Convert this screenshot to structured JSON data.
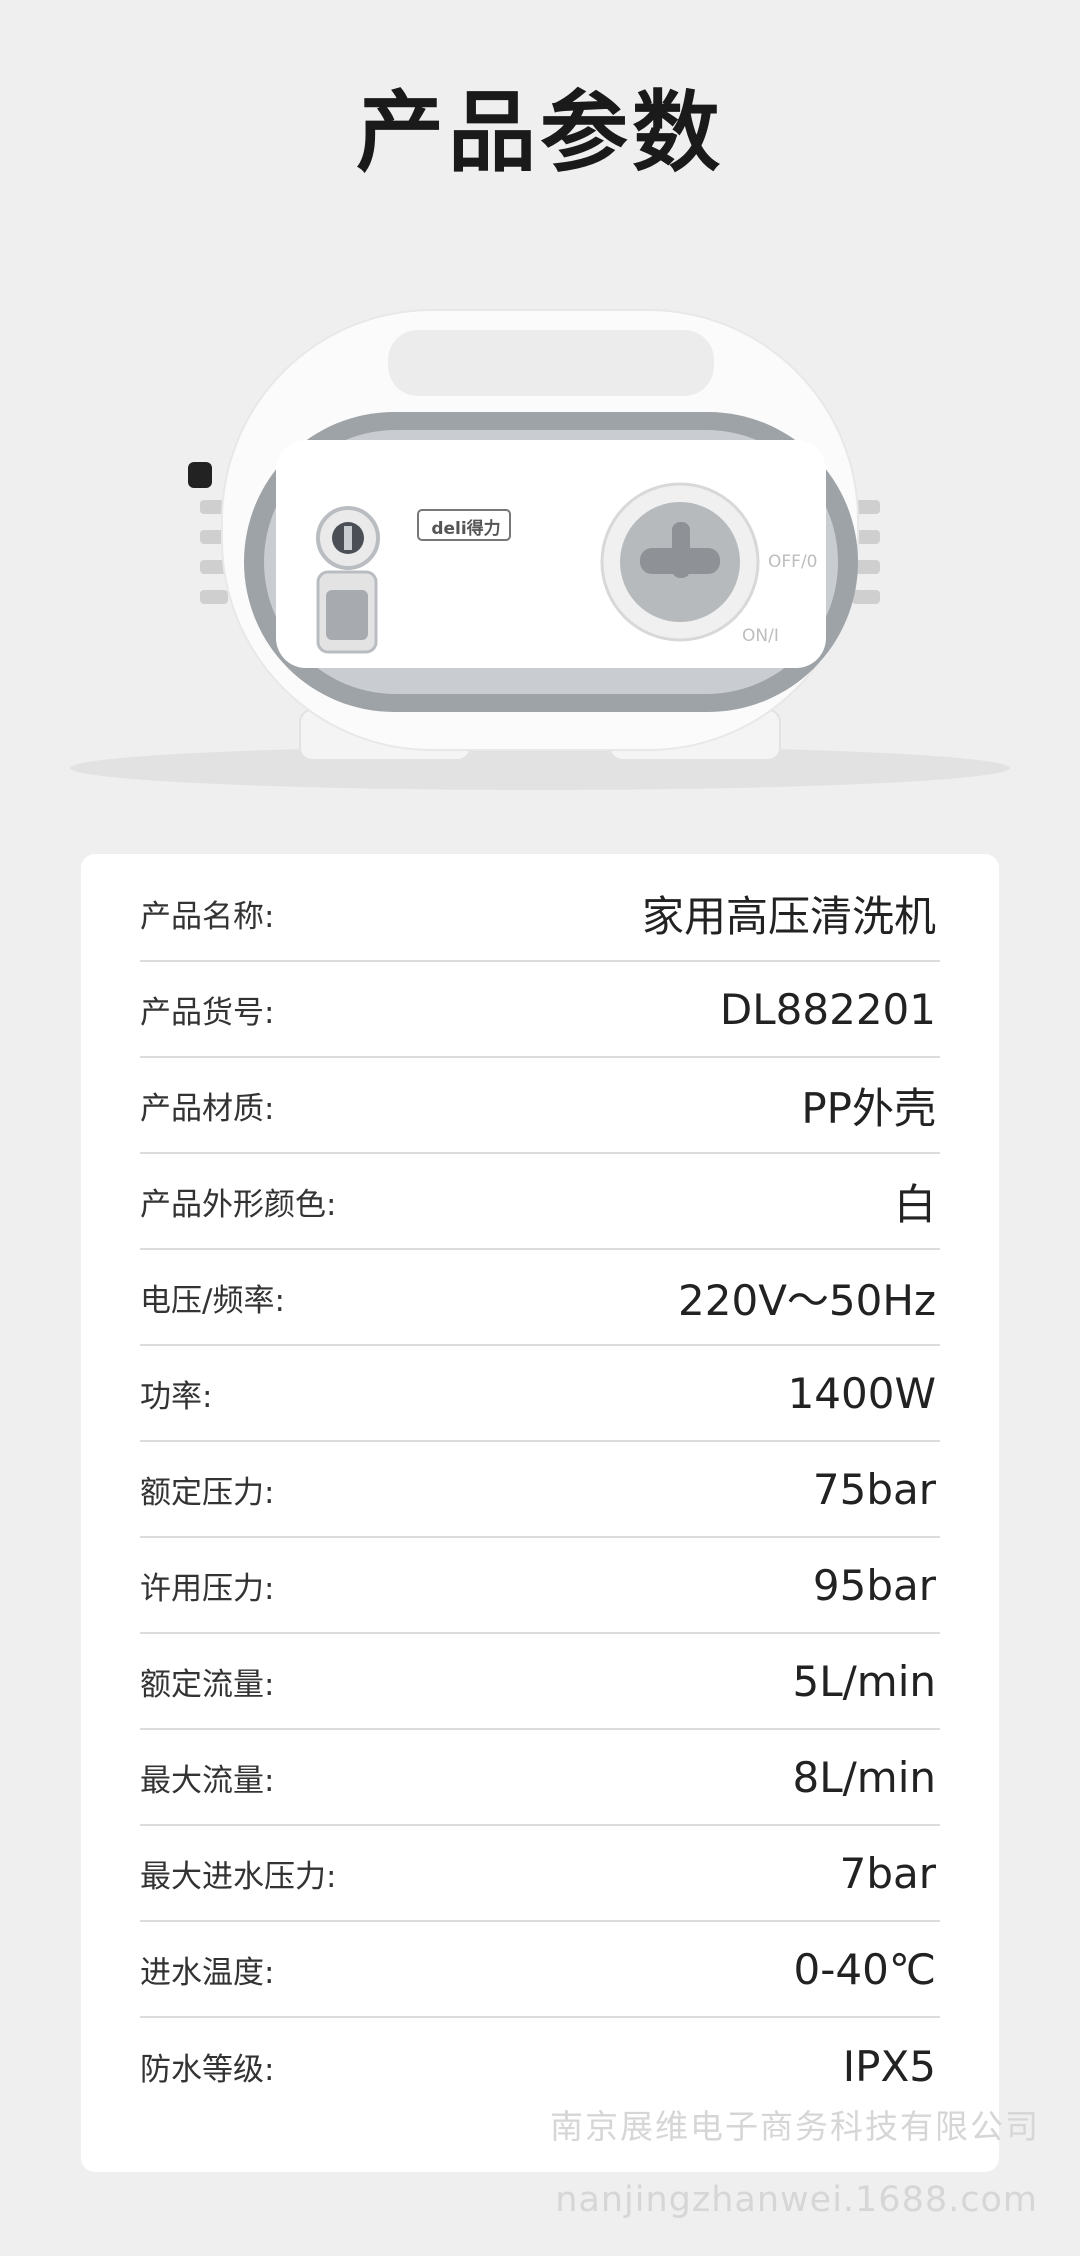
{
  "header": {
    "title": "产品参数"
  },
  "product": {
    "brand_logo": "deli得力",
    "switch_off_label": "OFF/0",
    "switch_on_label": "ON/I"
  },
  "specs": [
    {
      "label": "产品名称:",
      "value": "家用高压清洗机"
    },
    {
      "label": "产品货号:",
      "value": "DL882201"
    },
    {
      "label": "产品材质:",
      "value": "PP外壳"
    },
    {
      "label": "产品外形颜色:",
      "value": "白"
    },
    {
      "label": "电压/频率:",
      "value": "220V～50Hz"
    },
    {
      "label": "功率:",
      "value": "1400W"
    },
    {
      "label": "额定压力:",
      "value": "75bar"
    },
    {
      "label": "许用压力:",
      "value": "95bar"
    },
    {
      "label": "额定流量:",
      "value": "5L/min"
    },
    {
      "label": "最大流量:",
      "value": "8L/min"
    },
    {
      "label": "最大进水压力:",
      "value": "7bar"
    },
    {
      "label": "进水温度:",
      "value": "0-40℃"
    },
    {
      "label": "防水等级:",
      "value": "IPX5"
    }
  ],
  "watermark": {
    "company": "南京展维电子商务科技有限公司",
    "url": "nanjingzhanwei.1688.com"
  },
  "colors": {
    "background": "#efefef",
    "card": "#ffffff",
    "device_trim": "#9aa0a6"
  }
}
